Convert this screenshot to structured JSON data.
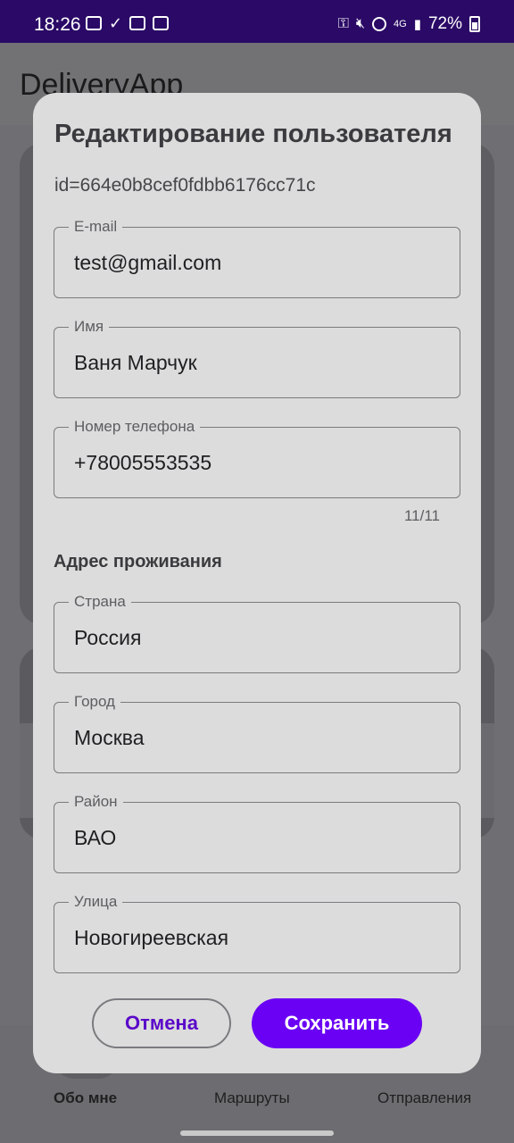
{
  "status_bar": {
    "time": "18:26",
    "battery": "72%",
    "network": "4G"
  },
  "app": {
    "title": "DeliveryApp"
  },
  "bottom_nav": {
    "items": [
      {
        "label": "Обо мне",
        "active": true
      },
      {
        "label": "Маршруты",
        "active": false
      },
      {
        "label": "Отправления",
        "active": false
      }
    ]
  },
  "dialog": {
    "title": "Редактирование пользователя",
    "id_text": "id=664e0b8cef0fdbb6176cc71c",
    "fields": {
      "email": {
        "label": "E-mail",
        "value": "test@gmail.com"
      },
      "name": {
        "label": "Имя",
        "value": "Ваня Марчук"
      },
      "phone": {
        "label": "Номер телефона",
        "value": "+78005553535",
        "counter": "11/11"
      }
    },
    "address_section_title": "Адрес проживания",
    "address": {
      "country": {
        "label": "Страна",
        "value": "Россия"
      },
      "city": {
        "label": "Город",
        "value": "Москва"
      },
      "district": {
        "label": "Район",
        "value": "ВАО"
      },
      "street": {
        "label": "Улица",
        "value": "Новогиреевская"
      }
    },
    "buttons": {
      "cancel": "Отмена",
      "save": "Сохранить"
    }
  },
  "colors": {
    "accent": "#6a00f4",
    "status_bar": "#2a0a66",
    "dialog_bg": "#dcdcdc"
  }
}
